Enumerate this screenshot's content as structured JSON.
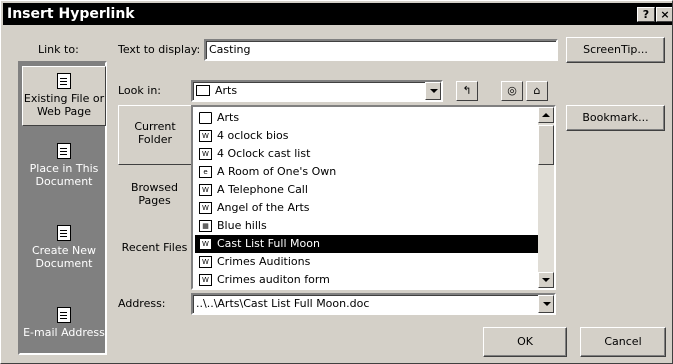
{
  "title": "Insert Hyperlink",
  "title_buttons": {
    "help": "?",
    "close": "×"
  },
  "link_to_label": "Link to:",
  "text_to_display": {
    "label": "Text to display:",
    "value": "Casting"
  },
  "screentip_label": "ScreenTip...",
  "sidebar": [
    {
      "label": "Existing File or Web Page",
      "selected": true
    },
    {
      "label": "Place in This Document",
      "selected": false
    },
    {
      "label": "Create New Document",
      "selected": false
    },
    {
      "label": "E-mail Address",
      "selected": false
    }
  ],
  "look_in": {
    "label": "Look in:",
    "value": "Arts"
  },
  "tabs": [
    {
      "label": "Current Folder",
      "selected": true
    },
    {
      "label": "Browsed Pages",
      "selected": false
    },
    {
      "label": "Recent Files",
      "selected": false
    }
  ],
  "files": [
    {
      "name": "Arts",
      "icon": "folder-icon"
    },
    {
      "name": "4 oclock bios",
      "icon": "word-doc-icon"
    },
    {
      "name": "4 Oclock cast list",
      "icon": "word-doc-icon"
    },
    {
      "name": "A Room of One's Own",
      "icon": "web-page-icon"
    },
    {
      "name": "A Telephone Call",
      "icon": "word-doc-icon"
    },
    {
      "name": "Angel of the Arts",
      "icon": "word-doc-icon"
    },
    {
      "name": "Blue hills",
      "icon": "image-icon"
    },
    {
      "name": "Cast List Full Moon",
      "icon": "word-doc-icon",
      "selected": true
    },
    {
      "name": "Crimes Auditions",
      "icon": "word-doc-icon"
    },
    {
      "name": "Crimes auditon form",
      "icon": "word-doc-icon"
    }
  ],
  "bookmark_label": "Bookmark...",
  "address": {
    "label": "Address:",
    "value": "..\\..\\Arts\\Cast List Full Moon.doc"
  },
  "ok_label": "OK",
  "cancel_label": "Cancel"
}
